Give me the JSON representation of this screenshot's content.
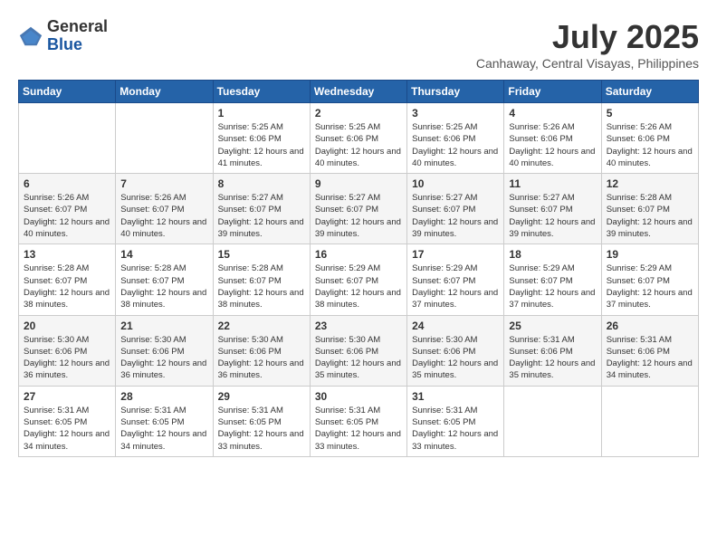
{
  "logo": {
    "general": "General",
    "blue": "Blue"
  },
  "title": {
    "month_year": "July 2025",
    "location": "Canhaway, Central Visayas, Philippines"
  },
  "days_of_week": [
    "Sunday",
    "Monday",
    "Tuesday",
    "Wednesday",
    "Thursday",
    "Friday",
    "Saturday"
  ],
  "weeks": [
    {
      "row_class": "row-white",
      "days": [
        {
          "num": "",
          "info": ""
        },
        {
          "num": "",
          "info": ""
        },
        {
          "num": "1",
          "info": "Sunrise: 5:25 AM\nSunset: 6:06 PM\nDaylight: 12 hours and 41 minutes."
        },
        {
          "num": "2",
          "info": "Sunrise: 5:25 AM\nSunset: 6:06 PM\nDaylight: 12 hours and 40 minutes."
        },
        {
          "num": "3",
          "info": "Sunrise: 5:25 AM\nSunset: 6:06 PM\nDaylight: 12 hours and 40 minutes."
        },
        {
          "num": "4",
          "info": "Sunrise: 5:26 AM\nSunset: 6:06 PM\nDaylight: 12 hours and 40 minutes."
        },
        {
          "num": "5",
          "info": "Sunrise: 5:26 AM\nSunset: 6:06 PM\nDaylight: 12 hours and 40 minutes."
        }
      ]
    },
    {
      "row_class": "row-gray",
      "days": [
        {
          "num": "6",
          "info": "Sunrise: 5:26 AM\nSunset: 6:07 PM\nDaylight: 12 hours and 40 minutes."
        },
        {
          "num": "7",
          "info": "Sunrise: 5:26 AM\nSunset: 6:07 PM\nDaylight: 12 hours and 40 minutes."
        },
        {
          "num": "8",
          "info": "Sunrise: 5:27 AM\nSunset: 6:07 PM\nDaylight: 12 hours and 39 minutes."
        },
        {
          "num": "9",
          "info": "Sunrise: 5:27 AM\nSunset: 6:07 PM\nDaylight: 12 hours and 39 minutes."
        },
        {
          "num": "10",
          "info": "Sunrise: 5:27 AM\nSunset: 6:07 PM\nDaylight: 12 hours and 39 minutes."
        },
        {
          "num": "11",
          "info": "Sunrise: 5:27 AM\nSunset: 6:07 PM\nDaylight: 12 hours and 39 minutes."
        },
        {
          "num": "12",
          "info": "Sunrise: 5:28 AM\nSunset: 6:07 PM\nDaylight: 12 hours and 39 minutes."
        }
      ]
    },
    {
      "row_class": "row-white",
      "days": [
        {
          "num": "13",
          "info": "Sunrise: 5:28 AM\nSunset: 6:07 PM\nDaylight: 12 hours and 38 minutes."
        },
        {
          "num": "14",
          "info": "Sunrise: 5:28 AM\nSunset: 6:07 PM\nDaylight: 12 hours and 38 minutes."
        },
        {
          "num": "15",
          "info": "Sunrise: 5:28 AM\nSunset: 6:07 PM\nDaylight: 12 hours and 38 minutes."
        },
        {
          "num": "16",
          "info": "Sunrise: 5:29 AM\nSunset: 6:07 PM\nDaylight: 12 hours and 38 minutes."
        },
        {
          "num": "17",
          "info": "Sunrise: 5:29 AM\nSunset: 6:07 PM\nDaylight: 12 hours and 37 minutes."
        },
        {
          "num": "18",
          "info": "Sunrise: 5:29 AM\nSunset: 6:07 PM\nDaylight: 12 hours and 37 minutes."
        },
        {
          "num": "19",
          "info": "Sunrise: 5:29 AM\nSunset: 6:07 PM\nDaylight: 12 hours and 37 minutes."
        }
      ]
    },
    {
      "row_class": "row-gray",
      "days": [
        {
          "num": "20",
          "info": "Sunrise: 5:30 AM\nSunset: 6:06 PM\nDaylight: 12 hours and 36 minutes."
        },
        {
          "num": "21",
          "info": "Sunrise: 5:30 AM\nSunset: 6:06 PM\nDaylight: 12 hours and 36 minutes."
        },
        {
          "num": "22",
          "info": "Sunrise: 5:30 AM\nSunset: 6:06 PM\nDaylight: 12 hours and 36 minutes."
        },
        {
          "num": "23",
          "info": "Sunrise: 5:30 AM\nSunset: 6:06 PM\nDaylight: 12 hours and 35 minutes."
        },
        {
          "num": "24",
          "info": "Sunrise: 5:30 AM\nSunset: 6:06 PM\nDaylight: 12 hours and 35 minutes."
        },
        {
          "num": "25",
          "info": "Sunrise: 5:31 AM\nSunset: 6:06 PM\nDaylight: 12 hours and 35 minutes."
        },
        {
          "num": "26",
          "info": "Sunrise: 5:31 AM\nSunset: 6:06 PM\nDaylight: 12 hours and 34 minutes."
        }
      ]
    },
    {
      "row_class": "row-white",
      "days": [
        {
          "num": "27",
          "info": "Sunrise: 5:31 AM\nSunset: 6:05 PM\nDaylight: 12 hours and 34 minutes."
        },
        {
          "num": "28",
          "info": "Sunrise: 5:31 AM\nSunset: 6:05 PM\nDaylight: 12 hours and 34 minutes."
        },
        {
          "num": "29",
          "info": "Sunrise: 5:31 AM\nSunset: 6:05 PM\nDaylight: 12 hours and 33 minutes."
        },
        {
          "num": "30",
          "info": "Sunrise: 5:31 AM\nSunset: 6:05 PM\nDaylight: 12 hours and 33 minutes."
        },
        {
          "num": "31",
          "info": "Sunrise: 5:31 AM\nSunset: 6:05 PM\nDaylight: 12 hours and 33 minutes."
        },
        {
          "num": "",
          "info": ""
        },
        {
          "num": "",
          "info": ""
        }
      ]
    }
  ]
}
